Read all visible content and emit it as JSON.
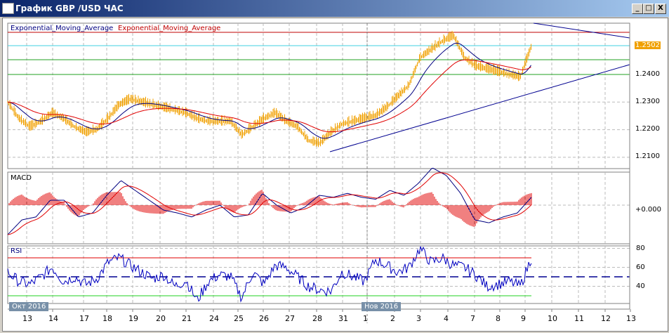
{
  "window": {
    "title": "График GBP /USD  ЧАС",
    "minimize": "_",
    "maximize": "□",
    "close": "X"
  },
  "legend": {
    "ema1": "Exponential_Moving_Average",
    "ema2": "Exponential_Moving_Average"
  },
  "price_axis": {
    "labels": [
      "1.2400",
      "1.2300",
      "1.2200",
      "1.2100"
    ],
    "current": "1.2502",
    "current_value": 1.2502
  },
  "macd": {
    "label": "MACD",
    "zero_label": "+0.000"
  },
  "rsi": {
    "label": "RSI",
    "labels": [
      "80",
      "60",
      "40"
    ],
    "upper": 70,
    "lower": 30,
    "mid": 50
  },
  "time_axis": {
    "labels": [
      "13",
      "14",
      "17",
      "18",
      "19",
      "20",
      "21",
      "24",
      "25",
      "26",
      "27",
      "28",
      "31",
      "1",
      "2",
      "3",
      "4",
      "7",
      "8",
      "9",
      "10",
      "11",
      "12",
      "13"
    ],
    "month1": "Окт 2016",
    "month2": "Нов 2016"
  },
  "colors": {
    "price": "#f0a000",
    "ema_fast": "#000080",
    "ema_slow": "#e00000",
    "level_red": "#c00000",
    "level_cyan": "#40d0e0",
    "level_green": "#20a020",
    "trend": "#000090"
  },
  "chart_data": {
    "type": "line",
    "price_series": [
      1.23,
      1.224,
      1.221,
      1.223,
      1.226,
      1.224,
      1.221,
      1.219,
      1.22,
      1.224,
      1.229,
      1.231,
      1.23,
      1.229,
      1.228,
      1.227,
      1.226,
      1.224,
      1.223,
      1.223,
      1.223,
      1.218,
      1.221,
      1.224,
      1.226,
      1.223,
      1.221,
      1.216,
      1.215,
      1.219,
      1.222,
      1.223,
      1.224,
      1.225,
      1.228,
      1.232,
      1.236,
      1.246,
      1.249,
      1.252,
      1.254,
      1.246,
      1.243,
      1.242,
      1.241,
      1.24,
      1.239,
      1.2502
    ],
    "rsi_series": [
      55,
      45,
      42,
      50,
      60,
      45,
      50,
      42,
      48,
      65,
      70,
      62,
      55,
      48,
      52,
      40,
      46,
      25,
      45,
      52,
      50,
      28,
      55,
      42,
      62,
      60,
      50,
      40,
      36,
      35,
      55,
      50,
      45,
      68,
      62,
      55,
      60,
      80,
      65,
      70,
      62,
      60,
      52,
      40,
      42,
      45,
      40,
      70
    ],
    "macd_series": [
      -0.003,
      -0.0015,
      -0.0012,
      0.0005,
      0.0005,
      -0.0012,
      -0.0008,
      0.001,
      0.0025,
      0.0015,
      0.0005,
      -0.0005,
      -0.0008,
      -0.0012,
      -0.0005,
      0,
      -0.0012,
      -0.001,
      0.0012,
      0,
      -0.0008,
      -0.0002,
      0.001,
      0.0008,
      0.0012,
      0.0008,
      0.0006,
      0.0015,
      0.001,
      0.0022,
      0.0038,
      0.003,
      0.0012,
      -0.0015,
      -0.0018,
      -0.0012,
      -0.0008,
      0.0008
    ]
  }
}
